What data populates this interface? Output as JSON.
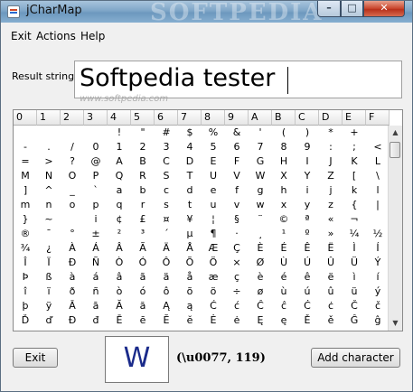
{
  "window": {
    "title": "jCharMap",
    "watermark": "SOFTPEDIA",
    "controls": {
      "minimize": "–",
      "maximize": "□",
      "close": "✕"
    }
  },
  "menu": [
    "Exit",
    "Actions",
    "Help"
  ],
  "result": {
    "label": "Result string:",
    "value": "Softpedia tester",
    "watermark": "www.softpedia.com"
  },
  "grid": {
    "columns": [
      "0",
      "1",
      "2",
      "3",
      "4",
      "5",
      "6",
      "7",
      "8",
      "9",
      "A",
      "B",
      "C",
      "D",
      "E",
      "F"
    ],
    "rows": [
      [
        "",
        "",
        "",
        "",
        "!",
        "\"",
        "#",
        "$",
        "%",
        "&",
        "'",
        "(",
        ")",
        "*",
        "+",
        ""
      ],
      [
        "-",
        ".",
        "/",
        "0",
        "1",
        "2",
        "3",
        "4",
        "5",
        "6",
        "7",
        "8",
        "9",
        ":",
        ";",
        "<"
      ],
      [
        "=",
        ">",
        "?",
        "@",
        "A",
        "B",
        "C",
        "D",
        "E",
        "F",
        "G",
        "H",
        "I",
        "J",
        "K",
        "L"
      ],
      [
        "M",
        "N",
        "O",
        "P",
        "Q",
        "R",
        "S",
        "T",
        "U",
        "V",
        "W",
        "X",
        "Y",
        "Z",
        "[",
        "\\"
      ],
      [
        "]",
        "^",
        "_",
        "`",
        "a",
        "b",
        "c",
        "d",
        "e",
        "f",
        "g",
        "h",
        "i",
        "j",
        "k",
        "l"
      ],
      [
        "m",
        "n",
        "o",
        "p",
        "q",
        "r",
        "s",
        "t",
        "u",
        "v",
        "w",
        "x",
        "y",
        "z",
        "{",
        "|"
      ],
      [
        "}",
        "~",
        "",
        "i",
        "¢",
        "£",
        "¤",
        "¥",
        "¦",
        "§",
        "¨",
        "©",
        "ª",
        "«",
        "¬",
        ""
      ],
      [
        "®",
        "¯",
        "°",
        "±",
        "²",
        "³",
        "´",
        "µ",
        "¶",
        "·",
        "¸",
        "¹",
        "º",
        "»",
        "¼",
        "½"
      ],
      [
        "¾",
        "¿",
        "À",
        "Á",
        "Â",
        "Ã",
        "Ä",
        "Å",
        "Æ",
        "Ç",
        "È",
        "É",
        "Ê",
        "Ë",
        "Ì",
        "Í"
      ],
      [
        "Î",
        "Ï",
        "Ð",
        "Ñ",
        "Ò",
        "Ó",
        "Ô",
        "Õ",
        "Ö",
        "×",
        "Ø",
        "Ù",
        "Ú",
        "Û",
        "Ü",
        "Ý"
      ],
      [
        "Þ",
        "ß",
        "à",
        "á",
        "â",
        "ã",
        "ä",
        "å",
        "æ",
        "ç",
        "è",
        "é",
        "ê",
        "ë",
        "ì",
        "í"
      ],
      [
        "î",
        "ï",
        "ð",
        "ñ",
        "ò",
        "ó",
        "ô",
        "õ",
        "ö",
        "÷",
        "ø",
        "ù",
        "ú",
        "û",
        "ü",
        "ý"
      ],
      [
        "þ",
        "ÿ",
        "Ā",
        "ā",
        "Ă",
        "ă",
        "Ą",
        "ą",
        "Ć",
        "ć",
        "Ĉ",
        "ĉ",
        "Ċ",
        "ċ",
        "Č",
        "č"
      ],
      [
        "Ď",
        "ď",
        "Đ",
        "đ",
        "Ē",
        "ē",
        "Ĕ",
        "ĕ",
        "Ė",
        "ė",
        "Ę",
        "ę",
        "Ě",
        "ě",
        "Ĝ",
        "ĝ"
      ]
    ]
  },
  "scrollbar": {
    "up": "▲",
    "down": "▼"
  },
  "buttons": {
    "exit": "Exit",
    "add": "Add character"
  },
  "preview": {
    "char": "W",
    "code": "(\\u0077, 119)"
  }
}
